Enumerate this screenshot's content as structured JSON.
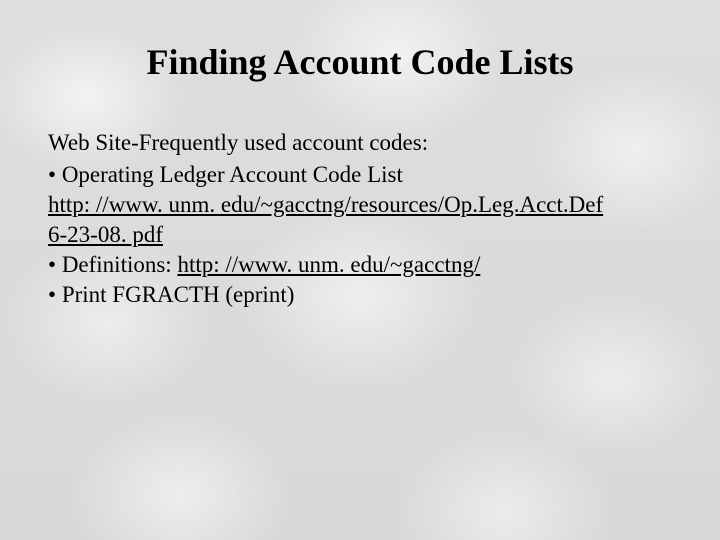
{
  "title": "Finding Account Code Lists",
  "body": {
    "lead": "Web Site-Frequently used account codes:",
    "bullet1_label": "Operating Ledger Account Code List",
    "link1_line1": "http: //www. unm. edu/~gacctng/resources/Op.Leg.Acct.Def",
    "link1_line2": "6-23-08. pdf",
    "bullet2_prefix": "Definitions: ",
    "link2": "http: //www. unm. edu/~gacctng/ ",
    "bullet3": "Print FGRACTH (eprint)"
  }
}
